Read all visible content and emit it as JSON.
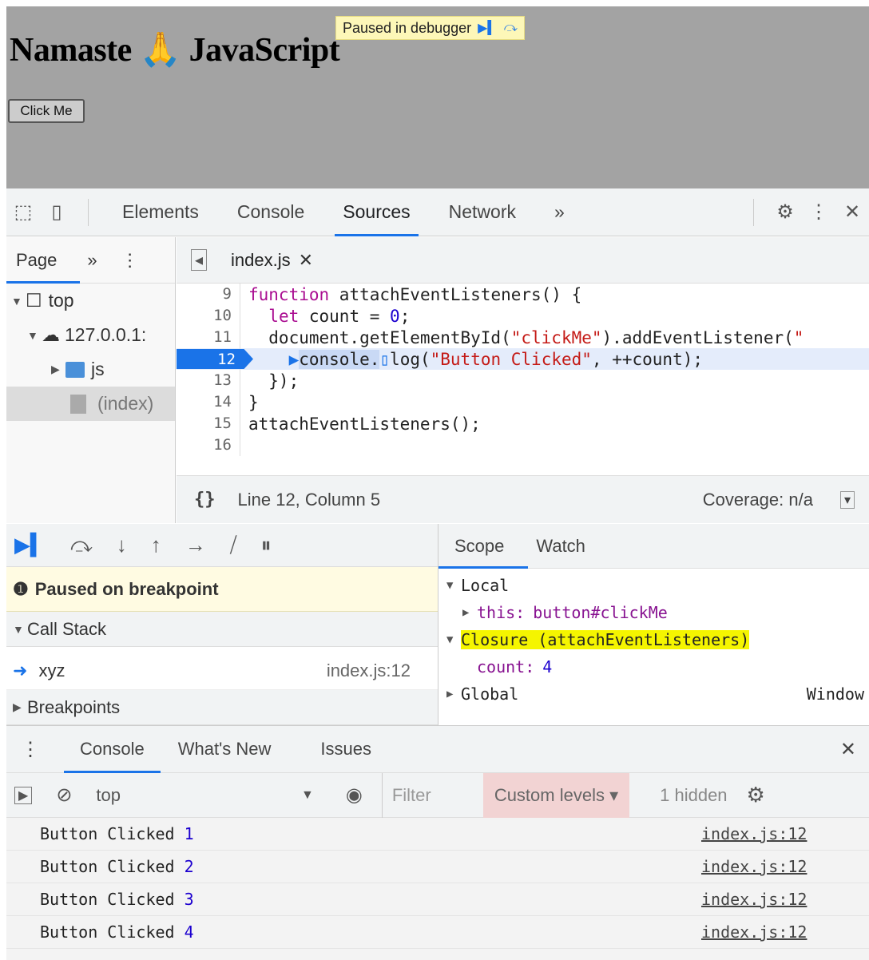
{
  "page": {
    "title": "Namaste 🙏 JavaScript",
    "paused_banner": "Paused in debugger",
    "button_label": "Click Me"
  },
  "devtools": {
    "tabs": [
      "Elements",
      "Console",
      "Sources",
      "Network"
    ],
    "active_tab": "Sources",
    "more_tabs": "»"
  },
  "navigator": {
    "header": "Page",
    "more": "»",
    "tree": [
      {
        "label": "top"
      },
      {
        "label": "127.0.0.1:"
      },
      {
        "label": "js"
      },
      {
        "label": "(index)"
      }
    ]
  },
  "editor": {
    "file_tab": "index.js",
    "footer_position": "Line 12, Column 5",
    "footer_coverage": "Coverage: n/a",
    "active_line": 12,
    "lines": [
      {
        "n": "9"
      },
      {
        "n": "10"
      },
      {
        "n": "11"
      },
      {
        "n": "12"
      },
      {
        "n": "13"
      },
      {
        "n": "14"
      },
      {
        "n": "15"
      },
      {
        "n": "16"
      }
    ]
  },
  "debugger": {
    "paused_message": "Paused on breakpoint",
    "call_stack_header": "Call Stack",
    "call_stack": [
      {
        "fn": "xyz",
        "loc": "index.js:12"
      }
    ],
    "breakpoints_header": "Breakpoints"
  },
  "scope": {
    "tabs": [
      "Scope",
      "Watch"
    ],
    "local_label": "Local",
    "this_key": "this:",
    "this_val": "button#clickMe",
    "closure_label": "Closure (attachEventListeners)",
    "count_key": "count:",
    "count_val": "4",
    "global_label": "Global",
    "global_val": "Window"
  },
  "console": {
    "tabs": [
      "Console",
      "What's New",
      "Issues"
    ],
    "context": "top",
    "filter_placeholder": "Filter",
    "levels": "Custom levels ▾",
    "hidden": "1 hidden",
    "logs": [
      {
        "text": "Button Clicked",
        "count": "1",
        "src": "index.js:12"
      },
      {
        "text": "Button Clicked",
        "count": "2",
        "src": "index.js:12"
      },
      {
        "text": "Button Clicked",
        "count": "3",
        "src": "index.js:12"
      },
      {
        "text": "Button Clicked",
        "count": "4",
        "src": "index.js:12"
      }
    ]
  },
  "colors": {
    "accent": "#1a73e8",
    "highlight": "#f5f500",
    "paused_bg": "#fdf7b8"
  }
}
